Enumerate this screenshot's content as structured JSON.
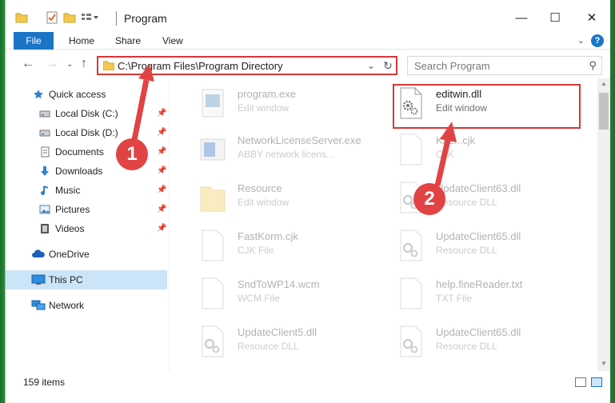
{
  "window": {
    "title": "Program",
    "controls": {
      "minimize": "—",
      "maximize": "☐",
      "close": "✕"
    }
  },
  "ribbon": {
    "tabs": [
      "File",
      "Home",
      "Share",
      "View"
    ],
    "help": "?"
  },
  "nav": {
    "address": "C:\\Program Files\\Program Directory",
    "search_placeholder": "Search Program"
  },
  "sidebar": {
    "items": [
      {
        "label": "Quick access",
        "icon": "star-icon",
        "pinned": false
      },
      {
        "label": "Local Disk (C:)",
        "icon": "drive-icon",
        "pinned": true
      },
      {
        "label": "Local Disk (D:)",
        "icon": "drive-icon",
        "pinned": true
      },
      {
        "label": "Documents",
        "icon": "documents-icon",
        "pinned": true
      },
      {
        "label": "Downloads",
        "icon": "download-icon",
        "pinned": true
      },
      {
        "label": "Music",
        "icon": "music-icon",
        "pinned": true
      },
      {
        "label": "Pictures",
        "icon": "pictures-icon",
        "pinned": true
      },
      {
        "label": "Videos",
        "icon": "videos-icon",
        "pinned": true
      },
      {
        "label": "OneDrive",
        "icon": "cloud-icon",
        "pinned": false
      },
      {
        "label": "This PC",
        "icon": "computer-icon",
        "pinned": false,
        "selected": true
      },
      {
        "label": "Network",
        "icon": "network-icon",
        "pinned": false
      }
    ]
  },
  "files": [
    {
      "name": "program.exe",
      "type": "Edit window",
      "icon": "exe-icon",
      "faded": true
    },
    {
      "name": "editwin.dll",
      "type": "Edit window",
      "icon": "dll-gear-icon",
      "faded": false,
      "highlighted": true
    },
    {
      "name": "NetworkLicenseServer.exe",
      "type": "ABBY network licens...",
      "icon": "exe-icon",
      "faded": true
    },
    {
      "name": "Kaz...cjk",
      "type": "CJK",
      "icon": "file-icon",
      "faded": true
    },
    {
      "name": "Resource",
      "type": "Edit window",
      "icon": "folder-icon",
      "faded": true
    },
    {
      "name": "UpdateClient63.dll",
      "type": "Resource DLL",
      "icon": "dll-gear-icon",
      "faded": true
    },
    {
      "name": "FastKorm.cjk",
      "type": "CJK File",
      "icon": "file-icon",
      "faded": true
    },
    {
      "name": "UpdateClient65.dll",
      "type": "Resource DLL",
      "icon": "dll-gear-icon",
      "faded": true
    },
    {
      "name": "SndToWP14.wcm",
      "type": "WCM File",
      "icon": "file-icon",
      "faded": true
    },
    {
      "name": "help.fineReader.txt",
      "type": "TXT File",
      "icon": "file-icon",
      "faded": true
    },
    {
      "name": "UpdateClient5.dll",
      "type": "Resource DLL",
      "icon": "dll-gear-icon",
      "faded": true
    },
    {
      "name": "UpdateClient65.dll",
      "type": "Resource DLL",
      "icon": "dll-gear-icon",
      "faded": true
    }
  ],
  "status": {
    "count": "159 items"
  },
  "callouts": [
    "1",
    "2"
  ],
  "colors": {
    "accent": "#1a75c7",
    "highlight": "#d43838",
    "callout": "#e14344",
    "selected": "#cce4f7"
  }
}
